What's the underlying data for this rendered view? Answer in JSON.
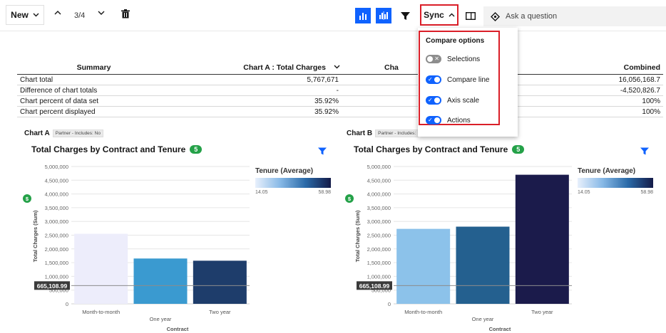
{
  "toolbar": {
    "new_label": "New",
    "page_count": "3/4",
    "sync_label": "Sync",
    "ask_placeholder": "Ask a question"
  },
  "compare_popup": {
    "title": "Compare options",
    "options": [
      {
        "label": "Selections",
        "enabled": false
      },
      {
        "label": "Compare line",
        "enabled": true
      },
      {
        "label": "Axis scale",
        "enabled": true
      },
      {
        "label": "Actions",
        "enabled": true
      }
    ]
  },
  "summary": {
    "headers": [
      "Summary",
      "Chart A : Total Charges",
      "Cha",
      "Combined"
    ],
    "rows": [
      {
        "label": "Chart total",
        "a": "5,767,671",
        "b": "",
        "combined": "16,056,168.7"
      },
      {
        "label": "Difference of chart totals",
        "a": "-",
        "b": "",
        "combined": "-4,520,826.7"
      },
      {
        "label": "Chart percent of data set",
        "a": "35.92%",
        "b": "",
        "combined": "100%"
      },
      {
        "label": "Chart percent displayed",
        "a": "35.92%",
        "b": "",
        "combined": "100%"
      }
    ]
  },
  "colors": {
    "accent": "#0f62fe",
    "highlight": "#da1e28",
    "badge": "#24a148"
  },
  "charts": [
    {
      "tag": "Chart A",
      "chip": "Partner - Includes: No",
      "title": "Total Charges by Contract and Tenure",
      "badge": "5",
      "legend_title": "Tenure (Average)",
      "legend_min": "14.05",
      "legend_max": "58.98",
      "ylabel": "Total Charges (Sum)",
      "xlabel": "Contract",
      "compare_value": "665,108.99",
      "y_marker": "$"
    },
    {
      "tag": "Chart B",
      "chip": "Partner - Includes:",
      "title": "Total Charges by Contract and Tenure",
      "badge": "5",
      "legend_title": "Tenure (Average)",
      "legend_min": "14.05",
      "legend_max": "58.98",
      "ylabel": "Total Charges (Sum)",
      "xlabel": "Contract",
      "compare_value": "665,108.99",
      "y_marker": "$"
    }
  ],
  "chart_data": [
    {
      "type": "bar",
      "title": "Total Charges by Contract and Tenure",
      "xlabel": "Contract",
      "ylabel": "Total Charges (Sum)",
      "categories": [
        "Month-to-month",
        "One year",
        "Two year"
      ],
      "values": [
        2550000,
        1650000,
        1570000
      ],
      "colors": [
        "#ededfb",
        "#3a9ad0",
        "#1e3d6b"
      ],
      "ylim": [
        0,
        5000000
      ],
      "yticks": [
        "0",
        "500,000",
        "1,000,000",
        "1,500,000",
        "2,000,000",
        "2,500,000",
        "3,000,000",
        "3,500,000",
        "4,000,000",
        "4,500,000",
        "5,000,000"
      ],
      "reference_line": 665108.99,
      "grid": true
    },
    {
      "type": "bar",
      "title": "Total Charges by Contract and Tenure",
      "xlabel": "Contract",
      "ylabel": "Total Charges (Sum)",
      "categories": [
        "Month-to-month",
        "One year",
        "Two year"
      ],
      "values": [
        2730000,
        2810000,
        4700000
      ],
      "colors": [
        "#8cc2ea",
        "#24608f",
        "#1b1b4b"
      ],
      "ylim": [
        0,
        5000000
      ],
      "yticks": [
        "0",
        "500,000",
        "1,000,000",
        "1,500,000",
        "2,000,000",
        "2,500,000",
        "3,000,000",
        "3,500,000",
        "4,000,000",
        "4,500,000",
        "5,000,000"
      ],
      "reference_line": 665108.99,
      "grid": true
    }
  ]
}
